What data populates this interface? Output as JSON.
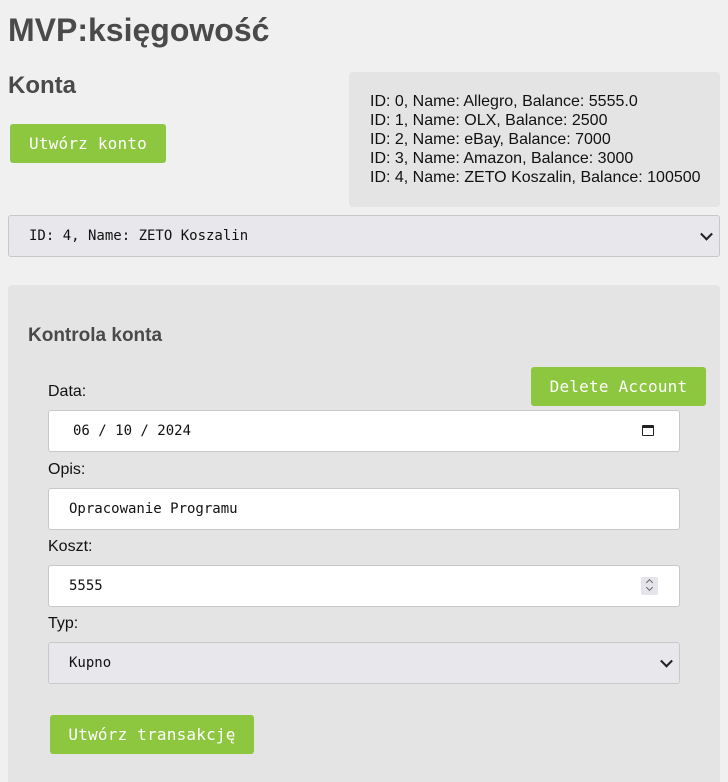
{
  "app": {
    "title": "MVP:księgowość"
  },
  "accounts_section": {
    "title": "Konta",
    "create_button_label": "Utwórz konto",
    "list": [
      "ID: 0, Name: Allegro, Balance: 5555.0",
      "ID: 1, Name: OLX, Balance: 2500",
      "ID: 2, Name: eBay, Balance: 7000",
      "ID: 3, Name: Amazon, Balance: 3000",
      "ID: 4, Name: ZETO Koszalin, Balance: 100500"
    ],
    "selected_account": "ID: 4, Name: ZETO Koszalin"
  },
  "control": {
    "title": "Kontrola konta",
    "delete_button_label": "Delete Account",
    "date": {
      "label": "Data:",
      "value": "06 / 10 / 2024"
    },
    "description": {
      "label": "Opis:",
      "value": "Opracowanie Programu"
    },
    "cost": {
      "label": "Koszt:",
      "value": "5555"
    },
    "type": {
      "label": "Typ:",
      "value": "Kupno"
    },
    "create_transaction_label": "Utwórz transakcję"
  },
  "colors": {
    "accent_green": "#8dc63f",
    "panel_bg": "#e4e4e4",
    "page_bg": "#f0f0f0"
  },
  "icons": {
    "date_picker": "calendar-icon",
    "number_spinner": "spinner-icon",
    "select_arrow": "chevron-down-icon"
  }
}
